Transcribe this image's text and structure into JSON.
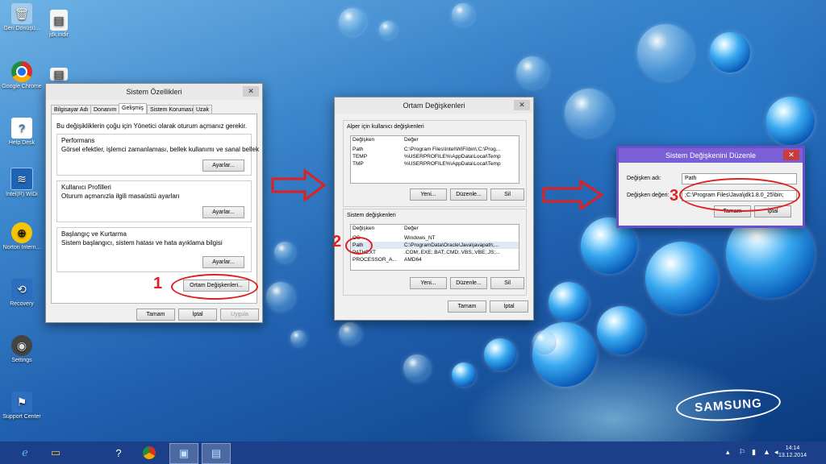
{
  "desktop": {
    "icons": [
      {
        "label": "Geri Dönüşü...",
        "icon": "recycle-bin-icon"
      },
      {
        "label": "jdk.indir",
        "icon": "file-icon"
      },
      {
        "label": "Google Chrome",
        "icon": "chrome-icon"
      },
      {
        "label": "Help Desk",
        "icon": "help-desk-icon"
      },
      {
        "label": "Intel(R) WiDi",
        "icon": "widi-icon"
      },
      {
        "label": "Norton Intern...",
        "icon": "norton-icon"
      },
      {
        "label": "Recovery",
        "icon": "recovery-icon"
      },
      {
        "label": "Settings",
        "icon": "settings-icon"
      },
      {
        "label": "Support Center",
        "icon": "support-icon"
      }
    ],
    "brand": "SAMSUNG"
  },
  "sysprops": {
    "title": "Sistem Özellikleri",
    "close": "✕",
    "tabs": [
      "Bilgisayar Adı",
      "Donanım",
      "Gelişmiş",
      "Sistem Koruması",
      "Uzak"
    ],
    "intro": "Bu değişikliklerin çoğu için Yönetici olarak oturum açmanız gerekir.",
    "perf_title": "Performans",
    "perf_desc": "Görsel efektler, işlemci zamanlaması, bellek kullanımı ve sanal bellek",
    "profiles_title": "Kullanıcı Profilleri",
    "profiles_desc": "Oturum açmanızla ilgili masaüstü ayarları",
    "startup_title": "Başlangıç ve Kurtarma",
    "startup_desc": "Sistem başlangıcı, sistem hatası ve hata ayıklama bilgisi",
    "settings_btn": "Ayarlar...",
    "env_btn": "Ortam Değişkenleri...",
    "ok": "Tamam",
    "cancel": "İptal",
    "apply": "Uygula"
  },
  "envvars": {
    "title": "Ortam Değişkenleri",
    "close": "✕",
    "user_group": "Alper için kullanıcı değişkenleri",
    "col_var": "Değişken",
    "col_val": "Değer",
    "user_vars": [
      {
        "name": "Path",
        "value": "C:\\Program Files\\Intel\\WiFi\\bin\\;C:\\Prog..."
      },
      {
        "name": "TEMP",
        "value": "%USERPROFILE%\\AppData\\Local\\Temp"
      },
      {
        "name": "TMP",
        "value": "%USERPROFILE%\\AppData\\Local\\Temp"
      }
    ],
    "sys_group": "Sistem değişkenleri",
    "sys_vars": [
      {
        "name": "OS",
        "value": "Windows_NT"
      },
      {
        "name": "Path",
        "value": "C:\\ProgramData\\Oracle\\Java\\javapath;..."
      },
      {
        "name": "PATHEXT",
        "value": ".COM;.EXE;.BAT;.CMD;.VBS;.VBE;.JS;..."
      },
      {
        "name": "PROCESSOR_A...",
        "value": "AMD64"
      }
    ],
    "new": "Yeni...",
    "edit": "Düzenle...",
    "delete": "Sil",
    "ok": "Tamam",
    "cancel": "İptal"
  },
  "editvar": {
    "title": "Sistem Değişkenini Düzenle",
    "close": "✕",
    "name_label": "Değişken adı:",
    "name_value": "Path",
    "value_label": "Değişken değeri:",
    "value_value": ";C:\\Program Files\\Java\\jdk1.8.0_25\\bin;",
    "ok": "Tamam",
    "cancel": "İptal"
  },
  "annotations": {
    "n1": "1",
    "n2": "2",
    "n3": "3",
    "color": "#e02020"
  },
  "taskbar": {
    "items": [
      "ie-icon",
      "explorer-icon",
      "help-icon",
      "chrome-icon",
      "system-icon",
      "active-window-icon"
    ],
    "time": "14:14",
    "date": "13.12.2014"
  }
}
